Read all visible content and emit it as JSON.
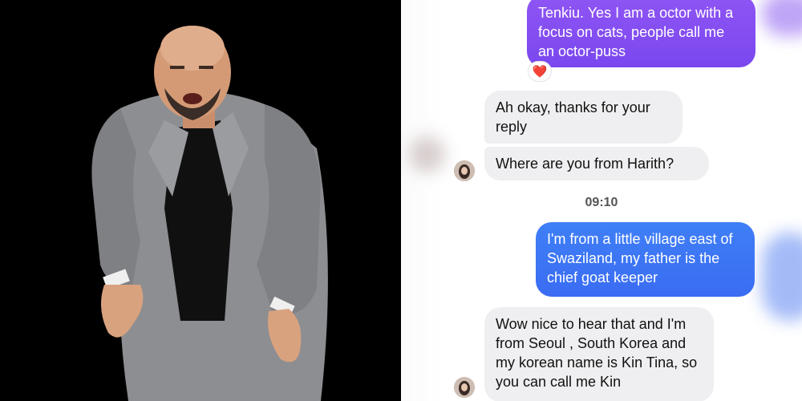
{
  "photo": {
    "subject": "man-in-grey-suit",
    "background_color": "#000000",
    "suit_color": "#8c8c8e",
    "shirt_color": "#111111"
  },
  "chat": {
    "messages": [
      {
        "id": "m1",
        "direction": "outgoing",
        "text": "Tenkiu. Yes I am a octor with a focus on cats, people call me an octor-puss",
        "reaction": "❤️"
      },
      {
        "id": "m2",
        "direction": "incoming",
        "text": "Ah okay, thanks for your reply"
      },
      {
        "id": "m3",
        "direction": "incoming",
        "text": "Where are you from  Harith?"
      },
      {
        "id": "m4",
        "direction": "outgoing",
        "text": "I'm from a little village east of Swaziland, my father is the chief goat keeper"
      },
      {
        "id": "m5",
        "direction": "incoming",
        "text": "Wow nice to hear that and I'm from Seoul , South Korea and my korean name is Kin Tina, so you can call me Kin"
      }
    ],
    "timestamp": "09:10",
    "colors": {
      "outgoing_purple": "#8a50f3",
      "outgoing_blue": "#3d76f5",
      "incoming_grey": "#efeff1",
      "reaction_heart": "#e5243b"
    }
  }
}
